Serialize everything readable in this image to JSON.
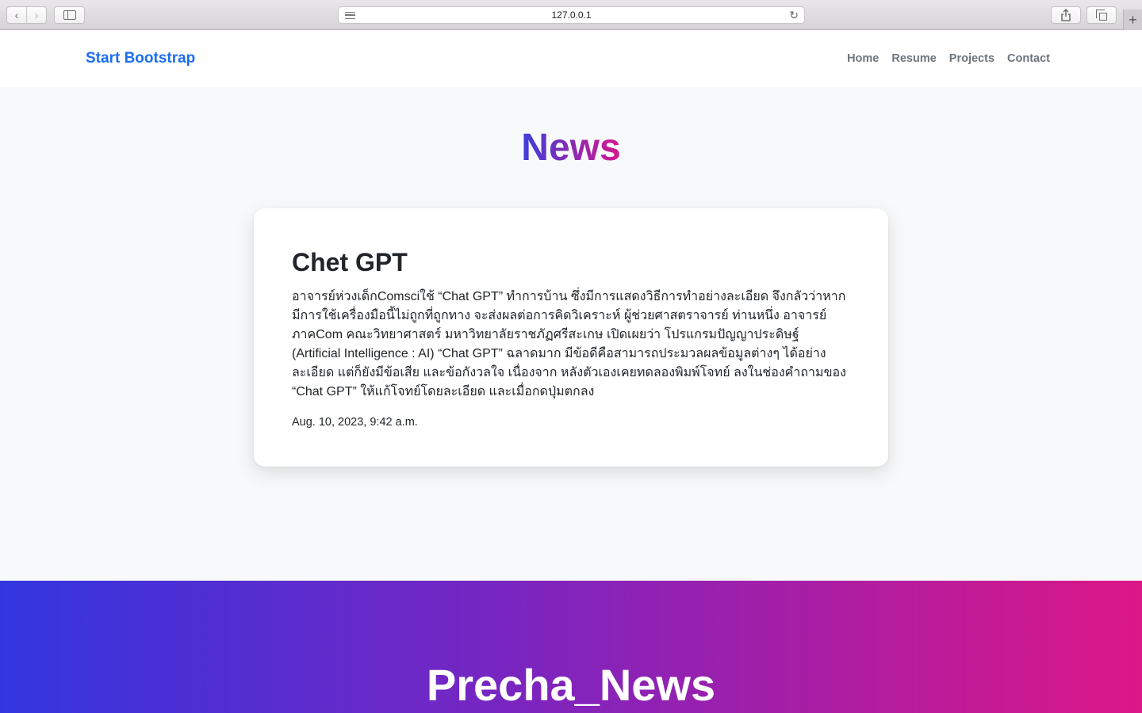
{
  "browser": {
    "url": "127.0.0.1"
  },
  "navbar": {
    "brand": "Start Bootstrap",
    "links": [
      "Home",
      "Resume",
      "Projects",
      "Contact"
    ]
  },
  "main": {
    "heading": "News",
    "card": {
      "title": "Chet GPT",
      "body": "อาจารย์ห่วงเด็กComsciใช้ “Chat GPT” ทำการบ้าน ซึ่งมีการแสดงวิธีการทำอย่างละเอียด จึงกลัวว่าหากมีการใช้เครื่องมือนี้ไม่ถูกที่ถูกทาง จะส่งผลต่อการคิดวิเคราะห์ ผู้ช่วยศาสตราจารย์ ท่านหนึ่ง อาจารย์ภาคCom คณะวิทยาศาสตร์ มหาวิทยาลัยราชภัฏศรีสะเกษ เปิดเผยว่า โปรแกรมปัญญาประดิษฐ์ (Artificial Intelligence : AI) “Chat GPT” ฉลาดมาก มีข้อดีคือสามารถประมวลผลข้อมูลต่างๆ ได้อย่างละเอียด แต่ก็ยังมีข้อเสีย และข้อกังวลใจ เนื่องจาก หลังตัวเองเคยทดลองพิมพ์โจทย์ ลงในช่องคำถามของ “Chat GPT” ให้แก้โจทย์โดยละเอียด และเมื่อกดปุ่มตกลง",
      "date": "Aug. 10, 2023, 9:42 a.m."
    }
  },
  "footer": {
    "title": "Precha_News"
  },
  "colors": {
    "brand": "#1b6ef3",
    "gradient_start": "#3336e0",
    "gradient_end": "#dc1787"
  }
}
